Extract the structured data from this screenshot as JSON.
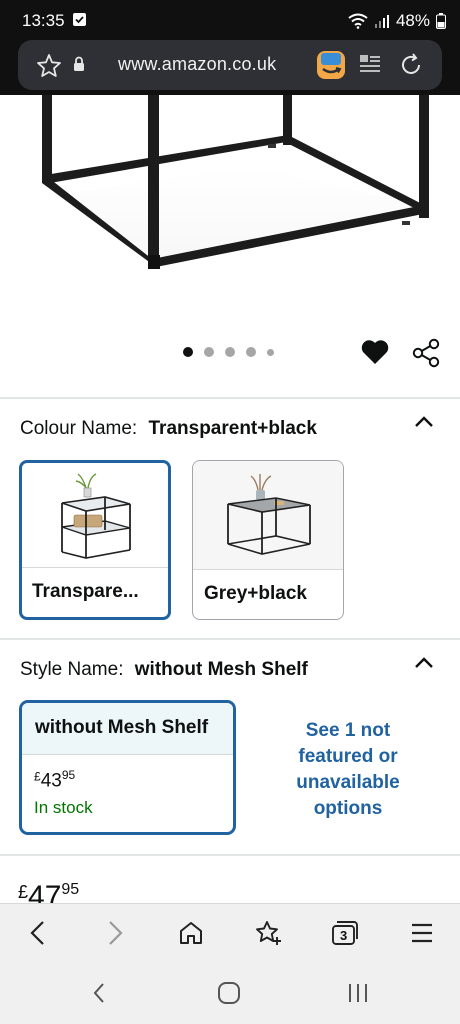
{
  "status_bar": {
    "time": "13:35",
    "battery": "48%"
  },
  "browser": {
    "url": "www.amazon.co.uk"
  },
  "gallery": {
    "dot_count": 5,
    "active_index": 0
  },
  "colour": {
    "label": "Colour Name:",
    "selected_value": "Transparent+black",
    "options": [
      {
        "label": "Transpare...",
        "selected": true
      },
      {
        "label": "Grey+black",
        "selected": false
      }
    ]
  },
  "style": {
    "label": "Style Name:",
    "selected_value": "without Mesh Shelf",
    "option": {
      "label": "without Mesh Shelf",
      "currency": "£",
      "price_whole": "43",
      "price_fraction": "95",
      "stock": "In stock"
    },
    "see_more": "See 1 not featured or unavailable options"
  },
  "price_partial": {
    "currency": "£",
    "whole": "47",
    "fraction": "95"
  },
  "toolbar": {
    "tabs_count": "3"
  },
  "colors": {
    "link_blue": "#2162a1",
    "stock_green": "#007600",
    "selected_border": "#2162a1"
  },
  "icons": [
    "star-icon",
    "lock-icon",
    "reader-icon",
    "reload-icon",
    "heart-icon",
    "share-icon",
    "chevron-up-icon",
    "back-icon",
    "forward-icon",
    "home-icon",
    "bookmark-add-icon",
    "tabs-icon",
    "menu-icon"
  ]
}
